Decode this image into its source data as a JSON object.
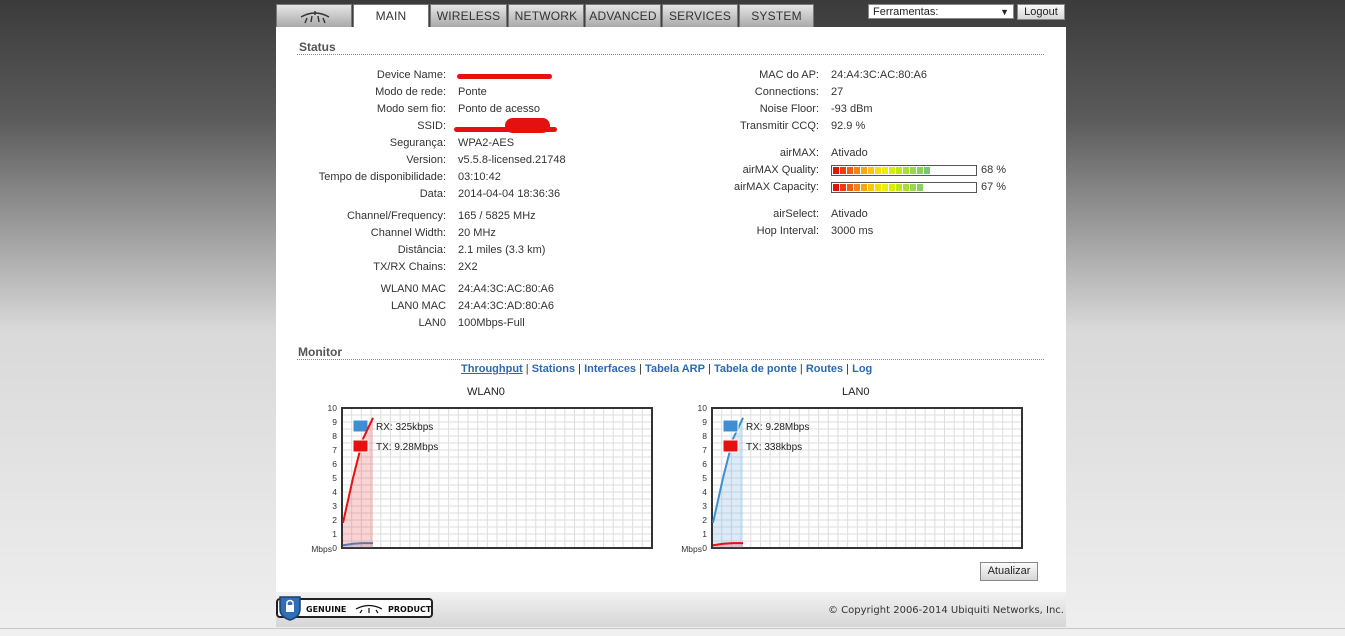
{
  "nav": {
    "tabs": [
      {
        "label": "MAIN"
      },
      {
        "label": "WIRELESS"
      },
      {
        "label": "NETWORK"
      },
      {
        "label": "ADVANCED"
      },
      {
        "label": "SERVICES"
      },
      {
        "label": "SYSTEM"
      }
    ],
    "tools_select": "Ferramentas:",
    "logout": "Logout"
  },
  "status": {
    "title": "Status",
    "left": [
      {
        "label": "Device Name:",
        "value": ""
      },
      {
        "label": "Modo de rede:",
        "value": "Ponte"
      },
      {
        "label": "Modo sem fio:",
        "value": "Ponto de acesso"
      },
      {
        "label": "SSID:",
        "value": ""
      },
      {
        "label": "Segurança:",
        "value": "WPA2-AES"
      },
      {
        "label": "Version:",
        "value": "v5.5.8-licensed.21748"
      },
      {
        "label": "Tempo de disponibilidade:",
        "value": "03:10:42"
      },
      {
        "label": "Data:",
        "value": "2014-04-04 18:36:36"
      },
      {
        "label": "Channel/Frequency:",
        "value": "165 / 5825 MHz"
      },
      {
        "label": "Channel Width:",
        "value": "20 MHz"
      },
      {
        "label": "Distância:",
        "value": "2.1 miles (3.3 km)"
      },
      {
        "label": "TX/RX Chains:",
        "value": "2X2"
      },
      {
        "label": "WLAN0 MAC",
        "value": "24:A4:3C:AC:80:A6"
      },
      {
        "label": "LAN0 MAC",
        "value": "24:A4:3C:AD:80:A6"
      },
      {
        "label": "LAN0",
        "value": "100Mbps-Full"
      }
    ],
    "right": [
      {
        "label": "MAC do AP:",
        "value": "24:A4:3C:AC:80:A6"
      },
      {
        "label": "Connections:",
        "value": "27"
      },
      {
        "label": "Noise Floor:",
        "value": "-93 dBm"
      },
      {
        "label": "Transmitir CCQ:",
        "value": "92.9 %"
      },
      {
        "label": "airMAX:",
        "value": "Ativado"
      },
      {
        "label": "airMAX Quality:",
        "value": "68 %",
        "level": 0.68
      },
      {
        "label": "airMAX Capacity:",
        "value": "67 %",
        "level": 0.67
      },
      {
        "label": "airSelect:",
        "value": "Ativado"
      },
      {
        "label": "Hop Interval:",
        "value": "3000 ms"
      }
    ]
  },
  "monitor": {
    "title": "Monitor",
    "links": [
      "Throughput",
      "Stations",
      "Interfaces",
      "Tabela ARP",
      "Tabela de ponte",
      "Routes",
      "Log"
    ],
    "active_link": "Throughput",
    "refresh": "Atualizar"
  },
  "chart_data": [
    {
      "type": "line",
      "title": "WLAN0",
      "ylabel": "Mbps",
      "ylim": [
        0,
        10
      ],
      "yticks": [
        "0",
        "1",
        "2",
        "3",
        "4",
        "5",
        "6",
        "7",
        "8",
        "9",
        "10"
      ],
      "grid": true,
      "legend": "top-left",
      "series": [
        {
          "name": "RX: 325kbps",
          "color": "#3d8fd1",
          "values": [
            0.2,
            0.3,
            0.35,
            0.35
          ]
        },
        {
          "name": "TX: 9.28Mbps",
          "color": "#e51010",
          "values": [
            1.8,
            5.0,
            7.8,
            9.3
          ]
        }
      ]
    },
    {
      "type": "line",
      "title": "LAN0",
      "ylabel": "Mbps",
      "ylim": [
        0,
        10
      ],
      "yticks": [
        "0",
        "1",
        "2",
        "3",
        "4",
        "5",
        "6",
        "7",
        "8",
        "9",
        "10"
      ],
      "grid": true,
      "legend": "top-left",
      "series": [
        {
          "name": "RX: 9.28Mbps",
          "color": "#3d8fd1",
          "values": [
            1.8,
            5.0,
            7.8,
            9.3
          ]
        },
        {
          "name": "TX: 338kbps",
          "color": "#e51010",
          "values": [
            0.2,
            0.3,
            0.35,
            0.35
          ]
        }
      ]
    }
  ],
  "footer": {
    "copyright": "© Copyright 2006-2014 Ubiquiti Networks, Inc.",
    "badge_left": "GENUINE",
    "badge_right": "PRODUCT"
  }
}
